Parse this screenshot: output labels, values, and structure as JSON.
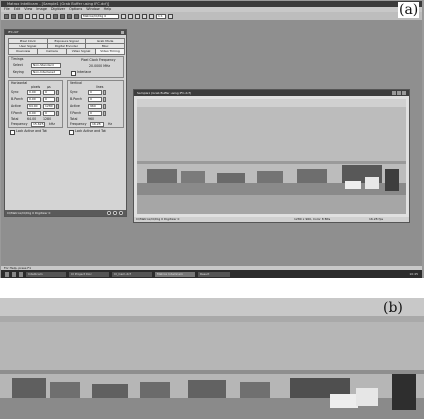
{
  "panel_a": {
    "label": "(a)",
    "app_title": "Matrox Intellicam - [Sample1 (Grab Buffer using IFC.dcf)]",
    "menu": [
      "File",
      "Edit",
      "View",
      "Image",
      "Digitizer",
      "Options",
      "Window",
      "Help"
    ],
    "toolbar": {
      "camera_field": "Matrox/Cl/Dig 0",
      "zoom_field": "1:1"
    },
    "dialog": {
      "title": "IFC.dcf",
      "tabs_row1": [
        "Pixel Clock",
        "Exposure Signal",
        "Grab Mode"
      ],
      "tabs_row2": [
        "User Signal",
        "Digital Encoder",
        "Misc"
      ],
      "tabs_row3": [
        "Overview",
        "Camera",
        "Video Signal",
        "Video Timing"
      ],
      "timings": {
        "header": "Timings",
        "timings_label": "Select",
        "timings_value": "Non-Standard",
        "keying_label": "Keying",
        "keying_value": "Non-Interlaced",
        "freq_header": "Pixel Clock Frequency",
        "freq_value": "20.0000 MHz",
        "interlace_label": "Interlace"
      },
      "horizontal": {
        "header": "Horizontal",
        "col_pixels": "pixels",
        "col_unit": "µs",
        "rows": [
          {
            "label": "Sync",
            "a": "0.00",
            "b": "0"
          },
          {
            "label": "B.Porch",
            "a": "0.00",
            "b": "0"
          },
          {
            "label": "Active",
            "a": "64.00",
            "b": "1280"
          },
          {
            "label": "F.Porch",
            "a": "0.00",
            "b": "0"
          }
        ],
        "total_label": "Total",
        "total_value": "64.00",
        "total_pixels": "1280",
        "freq_label": "Frequency",
        "freq_value": "15.625",
        "freq_unit": "kHz",
        "lock_label": "Lock Active and Tot"
      },
      "vertical": {
        "header": "Vertical",
        "col_unit": "lines",
        "rows": [
          {
            "label": "Sync",
            "a": "0"
          },
          {
            "label": "B.Porch",
            "a": "0"
          },
          {
            "label": "Active",
            "a": "960"
          },
          {
            "label": "F.Porch",
            "a": "0"
          }
        ],
        "total_label": "Total",
        "total_value": "960",
        "freq_label": "Frequency",
        "freq_value": "16.28",
        "freq_unit": "Hz",
        "lock_label": "Lock Active and Tot"
      },
      "status": "Cl/Matrox/Cl/Dig 0 Digitizer 0"
    },
    "capture_window": {
      "title": "Sample1 (Grab Buffer using IFC.dcf)",
      "status_left": "Cl/Matrox/Cl/Dig 0 Digitizer 0",
      "status_mid": "1280 x 960, Color 8 Bits",
      "status_right": "16.28 fps"
    },
    "status_bar": "For Help, press F1",
    "taskbar": [
      "Intellicam",
      "Cl Project Doc",
      "Cl_Cam.dcf",
      "Matrox Intellicam",
      "Result"
    ],
    "clock": "10:45"
  },
  "panel_b": {
    "label": "(b)"
  },
  "colors": {
    "frame": "#9a9a9a",
    "title_bar": "#3b3b3b",
    "dialog": "#d4d4d4",
    "photo": "#b4b4b4"
  }
}
